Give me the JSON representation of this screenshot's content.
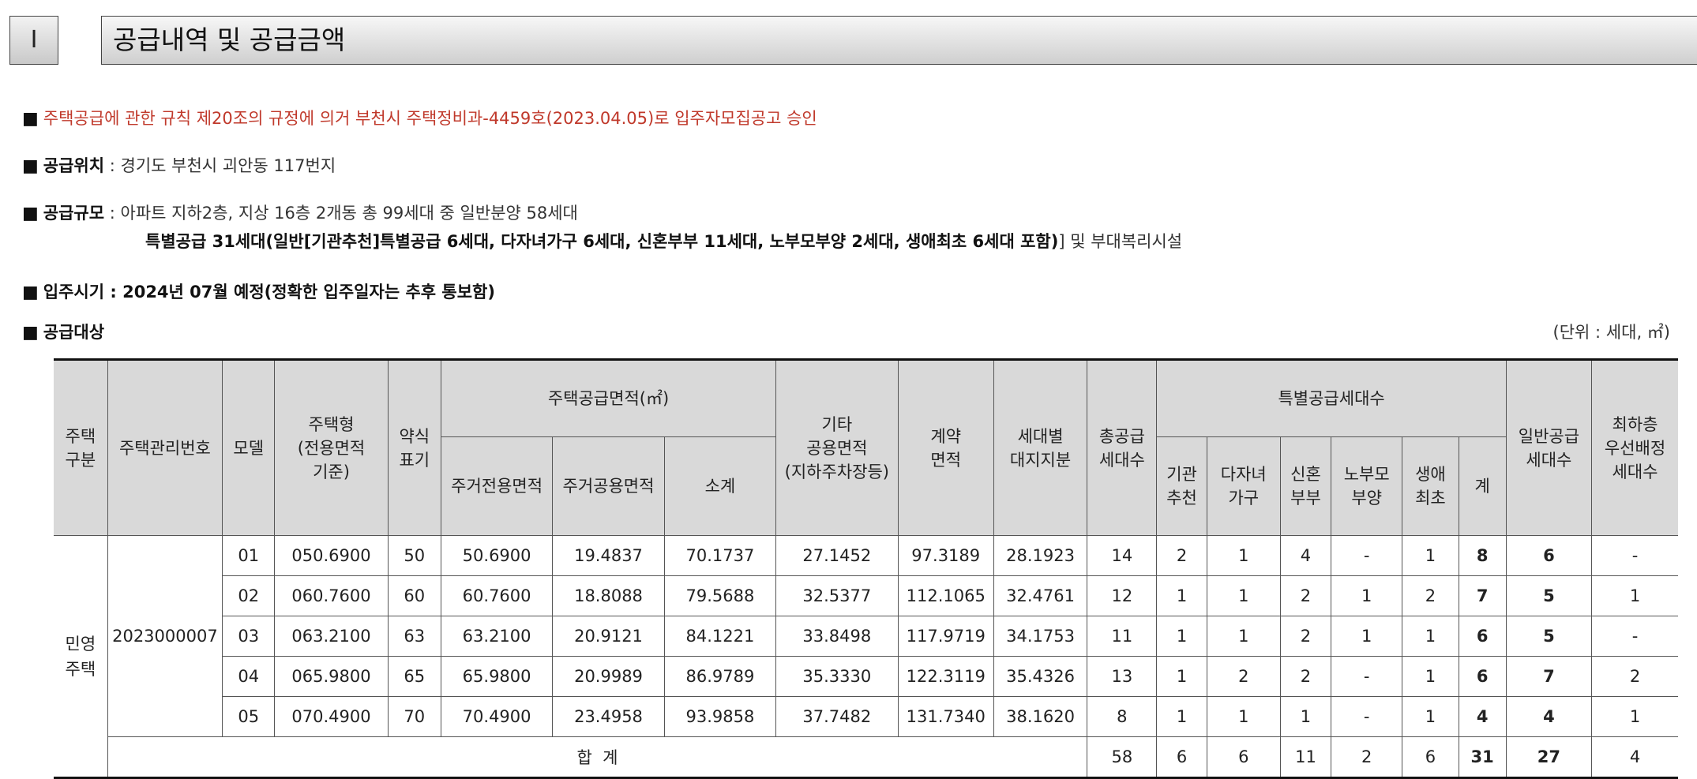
{
  "header": {
    "section_no": "I",
    "title": "공급내역 및 공급금액"
  },
  "notice": {
    "approval": "주택공급에 관한 규칙 제20조의 규정에 의거 부천시 주택정비과-4459호(2023.04.05)로 입주자모집공고 승인",
    "location_label": "공급위치",
    "location_value": ": 경기도 부천시 괴안동 117번지",
    "scale_label": "공급규모",
    "scale_line1": ": 아파트 지하2층, 지상 16층 2개동 총 99세대 중 일반분양 58세대",
    "scale_line2_bold": "특별공급 31세대(일반[기관추천]특별공급 6세대, 다자녀가구 6세대, 신혼부부 11세대, 노부모부양 2세대, 생애최초 6세대 포함)",
    "scale_line2_rest": "] 및 부대복리시설",
    "movein": "입주시기 : 2024년 07월 예정(정확한 입주일자는 추후 통보함)",
    "target_label": "공급대상",
    "unit": "(단위 : 세대, ㎡)"
  },
  "table": {
    "headers": {
      "type": "주택\n구분",
      "mgmt_no": "주택관리번호",
      "model": "모델",
      "house_type": "주택형\n(전용면적\n기준)",
      "abbr": "약식\n표기",
      "supply_area": "주택공급면적(㎡)",
      "exclusive": "주거전용면적",
      "common": "주거공용면적",
      "subtotal": "소계",
      "other_common": "기타\n공용면적\n(지하주차장등)",
      "contract": "계약\n면적",
      "land_share": "세대별\n대지지분",
      "total_units": "총공급\n세대수",
      "special": "특별공급세대수",
      "sp_inst": "기관\n추천",
      "sp_multi": "다자녀\n가구",
      "sp_newly": "신혼\n부부",
      "sp_parent": "노부모\n부양",
      "sp_first": "생애\n최초",
      "sp_sum": "계",
      "general": "일반공급\n세대수",
      "lowest": "최하층\n우선배정\n세대수"
    },
    "type_value": "민영\n주택",
    "mgmt_value": "2023000007",
    "rows": [
      {
        "model": "01",
        "house_type": "050.6900",
        "abbr": "50",
        "exclusive": "50.6900",
        "common": "19.4837",
        "subtotal": "70.1737",
        "other": "27.1452",
        "contract": "97.3189",
        "land": "28.1923",
        "total": "14",
        "inst": "2",
        "multi": "1",
        "newly": "4",
        "parent": "-",
        "first": "1",
        "sum": "8",
        "general": "6",
        "lowest": "-"
      },
      {
        "model": "02",
        "house_type": "060.7600",
        "abbr": "60",
        "exclusive": "60.7600",
        "common": "18.8088",
        "subtotal": "79.5688",
        "other": "32.5377",
        "contract": "112.1065",
        "land": "32.4761",
        "total": "12",
        "inst": "1",
        "multi": "1",
        "newly": "2",
        "parent": "1",
        "first": "2",
        "sum": "7",
        "general": "5",
        "lowest": "1"
      },
      {
        "model": "03",
        "house_type": "063.2100",
        "abbr": "63",
        "exclusive": "63.2100",
        "common": "20.9121",
        "subtotal": "84.1221",
        "other": "33.8498",
        "contract": "117.9719",
        "land": "34.1753",
        "total": "11",
        "inst": "1",
        "multi": "1",
        "newly": "2",
        "parent": "1",
        "first": "1",
        "sum": "6",
        "general": "5",
        "lowest": "-"
      },
      {
        "model": "04",
        "house_type": "065.9800",
        "abbr": "65",
        "exclusive": "65.9800",
        "common": "20.9989",
        "subtotal": "86.9789",
        "other": "35.3330",
        "contract": "122.3119",
        "land": "35.4326",
        "total": "13",
        "inst": "1",
        "multi": "2",
        "newly": "2",
        "parent": "-",
        "first": "1",
        "sum": "6",
        "general": "7",
        "lowest": "2"
      },
      {
        "model": "05",
        "house_type": "070.4900",
        "abbr": "70",
        "exclusive": "70.4900",
        "common": "23.4958",
        "subtotal": "93.9858",
        "other": "37.7482",
        "contract": "131.7340",
        "land": "38.1620",
        "total": "8",
        "inst": "1",
        "multi": "1",
        "newly": "1",
        "parent": "-",
        "first": "1",
        "sum": "4",
        "general": "4",
        "lowest": "1"
      }
    ],
    "sum_row": {
      "label": "합  계",
      "total": "58",
      "inst": "6",
      "multi": "6",
      "newly": "11",
      "parent": "2",
      "first": "6",
      "sum": "31",
      "general": "27",
      "lowest": "4"
    }
  }
}
